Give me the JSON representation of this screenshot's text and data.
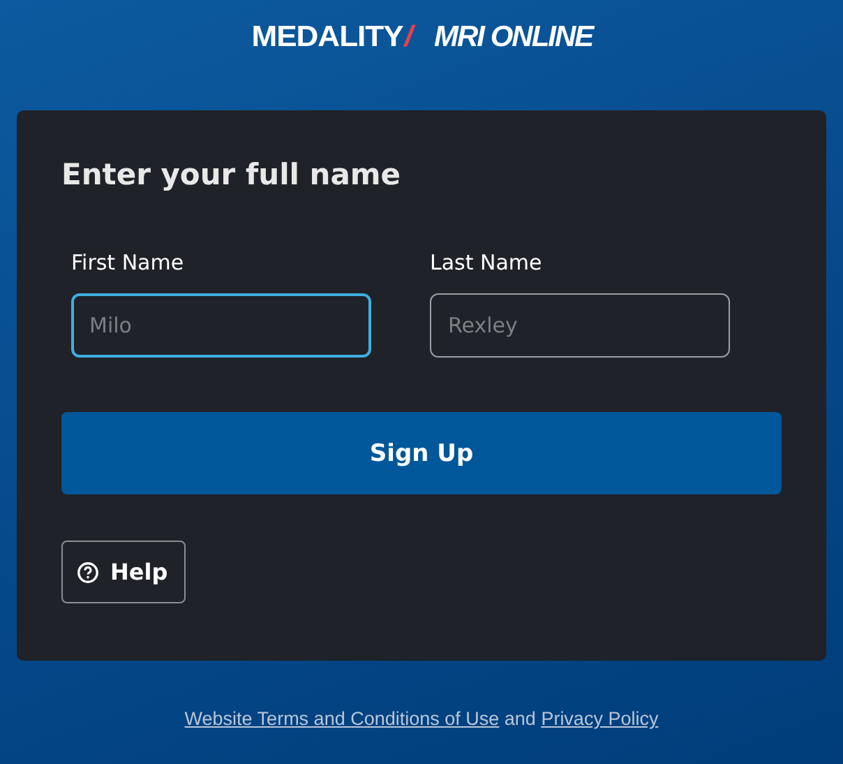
{
  "logo": {
    "brand": "MEDALITY",
    "separator": "/",
    "product": "MRI ONLINE"
  },
  "form": {
    "title": "Enter your full name",
    "fields": [
      {
        "label": "First Name",
        "placeholder": "Milo",
        "focused": true
      },
      {
        "label": "Last Name",
        "placeholder": "Rexley",
        "focused": false
      }
    ],
    "submit": "Sign Up",
    "help": "Help"
  },
  "footer": {
    "links": [
      "Website Terms and Conditions of Use",
      "Privacy Policy"
    ],
    "connector": "and"
  }
}
